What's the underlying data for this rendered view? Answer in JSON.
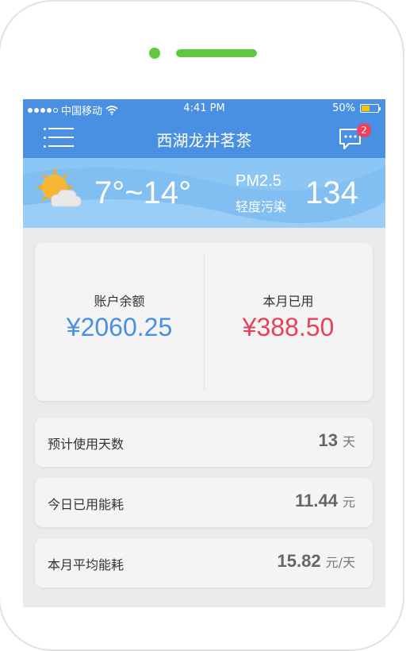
{
  "status_bar": {
    "carrier": "中国移动",
    "time": "4:41 PM",
    "battery": "50%",
    "battery_level": 0.5
  },
  "nav": {
    "title": "西湖龙井茗茶",
    "menu_icon": "menu-icon",
    "message_icon": "message-icon",
    "badge_count": "2"
  },
  "weather": {
    "icon": "partly-cloudy-icon",
    "temperature": "7°~14°",
    "pm_label": "PM2.5",
    "pm_level": "轻度污染",
    "aqi": "134"
  },
  "balance_card": {
    "balance_label": "账户余额",
    "balance_value": "¥2060.25",
    "used_label": "本月已用",
    "used_value": "¥388.50"
  },
  "stats": [
    {
      "label": "预计使用天数",
      "value": "13",
      "unit": "天"
    },
    {
      "label": "今日已用能耗",
      "value": "11.44",
      "unit": "元"
    },
    {
      "label": "本月平均能耗",
      "value": "15.82",
      "unit": "元/天"
    }
  ],
  "colors": {
    "primary": "#4a90e2",
    "weather_bg": "#8cc6f5",
    "balance_color": "#4a90e2",
    "used_color": "#e8415a",
    "badge": "#f2405c",
    "indicator": "#5ec93f"
  }
}
